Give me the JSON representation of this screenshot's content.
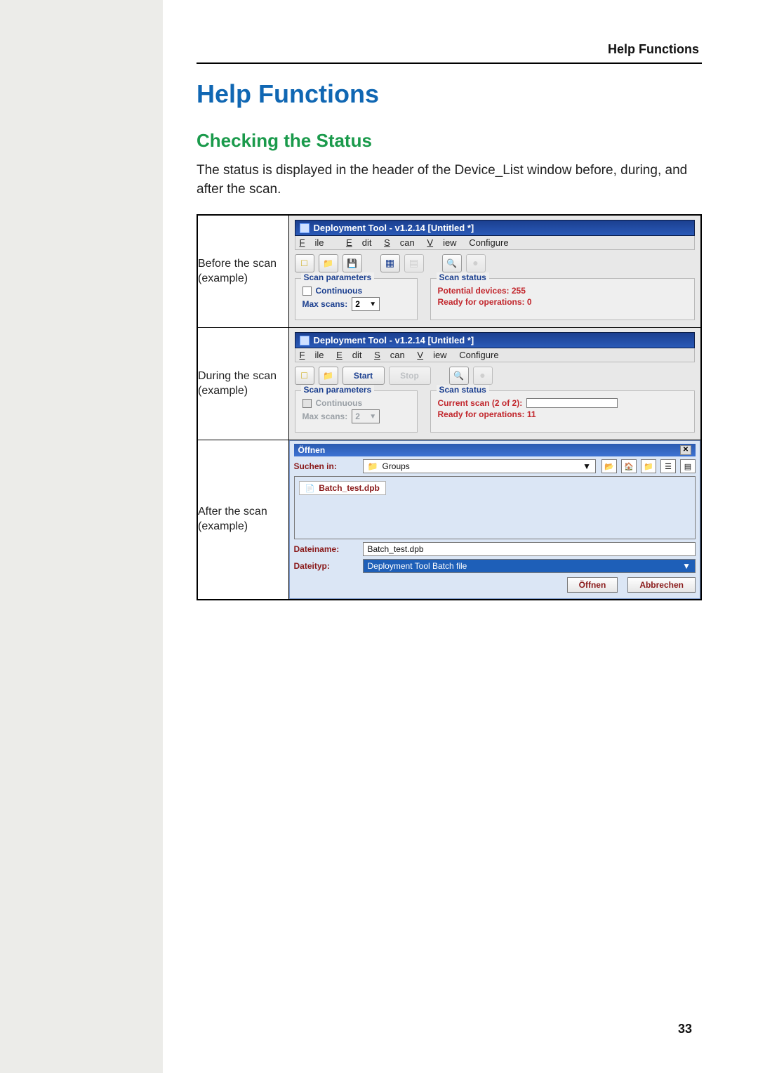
{
  "header": {
    "section": "Help Functions"
  },
  "title": "Help Functions",
  "subtitle": "Checking the Status",
  "intro": "The status is displayed in the header of the Device_List window before, during, and after the scan.",
  "rows": {
    "before": {
      "label": "Before the scan (example)"
    },
    "during": {
      "label": "During the scan (example)"
    },
    "after": {
      "label": "After the scan (example)"
    }
  },
  "shot_common": {
    "titlebar": "Deployment Tool - v1.2.14  [Untitled *]",
    "menu": {
      "file": "File",
      "edit": "Edit",
      "scan": "Scan",
      "view": "View",
      "configure": "Configure"
    },
    "group_params": "Scan parameters",
    "group_status": "Scan status",
    "continuous": "Continuous",
    "max_scans_label": "Max scans:",
    "max_scans_value": "2",
    "start": "Start",
    "stop": "Stop"
  },
  "shot_before": {
    "status_line1": "Potential devices: 255",
    "status_line2": "Ready for operations: 0"
  },
  "shot_during": {
    "status_line1": "Current scan (2 of 2):",
    "status_line2": "Ready for operations: 11"
  },
  "dialog": {
    "title": "Öffnen",
    "look_in_label": "Suchen in:",
    "look_in_value": "Groups",
    "file_item": "Batch_test.dpb",
    "filename_label": "Dateiname:",
    "filename_value": "Batch_test.dpb",
    "filetype_label": "Dateityp:",
    "filetype_value": "Deployment Tool Batch file",
    "open_btn": "Öffnen",
    "cancel_btn": "Abbrechen"
  },
  "page_number": "33"
}
